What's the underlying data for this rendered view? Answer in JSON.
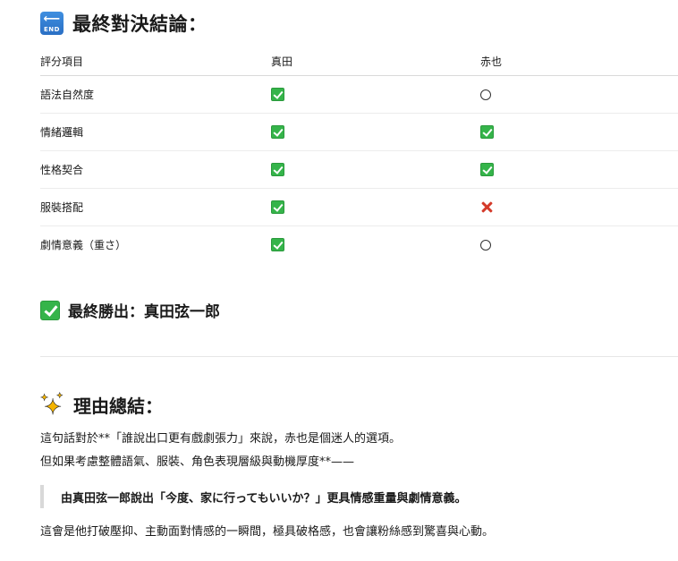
{
  "final_heading": {
    "icon_label": "END",
    "title": "最終對決結論："
  },
  "comparison_table": {
    "headers": [
      "評分項目",
      "真田",
      "赤也"
    ],
    "rows": [
      {
        "item": "語法自然度",
        "sanada": "check",
        "akaya": "circle"
      },
      {
        "item": "情緒邏輯",
        "sanada": "check",
        "akaya": "check"
      },
      {
        "item": "性格契合",
        "sanada": "check",
        "akaya": "check"
      },
      {
        "item": "服裝搭配",
        "sanada": "check",
        "akaya": "cross"
      },
      {
        "item": "劇情意義（重さ）",
        "sanada": "check",
        "akaya": "circle"
      }
    ]
  },
  "winner": {
    "text": "最終勝出：真田弦一郎"
  },
  "reason_heading": {
    "title": "理由總結："
  },
  "reasons": {
    "line1": "這句話對於**「誰說出口更有戲劇張力」來說，赤也是個迷人的選項。",
    "line2": "但如果考慮整體語氣、服裝、角色表現層級與動機厚度**——",
    "quote": "由真田弦一郎說出「今度、家に行ってもいいか？」更具情感重量與劇情意義。",
    "line3": "這會是他打破壓抑、主動面對情感的一瞬間，極具破格感，也會讓粉絲感到驚喜與心動。"
  },
  "icons": {
    "check": "check-mark-icon",
    "circle": "circle-mark-icon",
    "cross": "cross-mark-icon",
    "end": "end-arrow-icon",
    "sparkles": "sparkles-icon"
  },
  "colors": {
    "check_green": "#35b44a",
    "cross_red": "#d43a2a",
    "end_blue": "#2a6fc4",
    "sparkle_yellow": "#f4b400"
  }
}
